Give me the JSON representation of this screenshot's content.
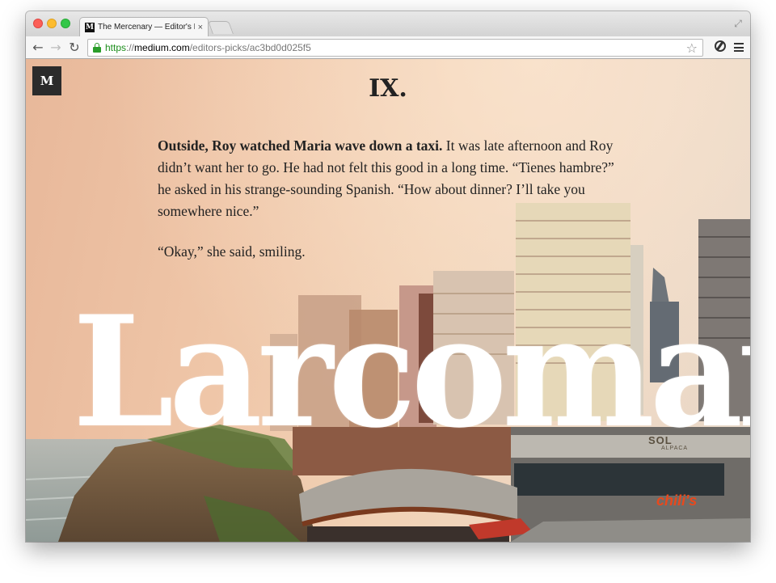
{
  "browser": {
    "tab": {
      "favicon": "M",
      "title": "The Mercenary — Editor's Picks",
      "close_glyph": "×"
    },
    "nav": {
      "back_glyph": "←",
      "forward_glyph": "→",
      "reload_glyph": "↻"
    },
    "address": {
      "scheme": "https",
      "separator": "://",
      "host": "medium.com",
      "path": "/editors-picks/ac3bd0d025f5"
    },
    "star_glyph": "☆",
    "fullscreen_glyph": "⤢",
    "icons": {
      "lock": "lock-icon",
      "extension": "extension-icon",
      "menu": "menu-icon"
    }
  },
  "page": {
    "logo": "M",
    "chapter": "IX.",
    "paragraphs": [
      {
        "lead": "Outside, Roy watched Maria wave down a taxi.",
        "text": " It was late afternoon and Roy didn’t want her to go. He had not felt this good in a long time. “Tienes hambre?” he asked in his strange-sounding Spanish. “How about dinner? I’ll take you somewhere nice.”"
      },
      {
        "lead": "",
        "text": "“Okay,” she said, smiling."
      }
    ],
    "hero_title": "Larcomar",
    "signs": {
      "sol": "SOL",
      "alpaca": "ALPACA",
      "chilis": "chili's"
    }
  },
  "colors": {
    "sky_warm": "#efc6a8",
    "logo_bg": "#2b2b2b",
    "url_green": "#1e8f1e",
    "title_white": "#ffffff"
  }
}
